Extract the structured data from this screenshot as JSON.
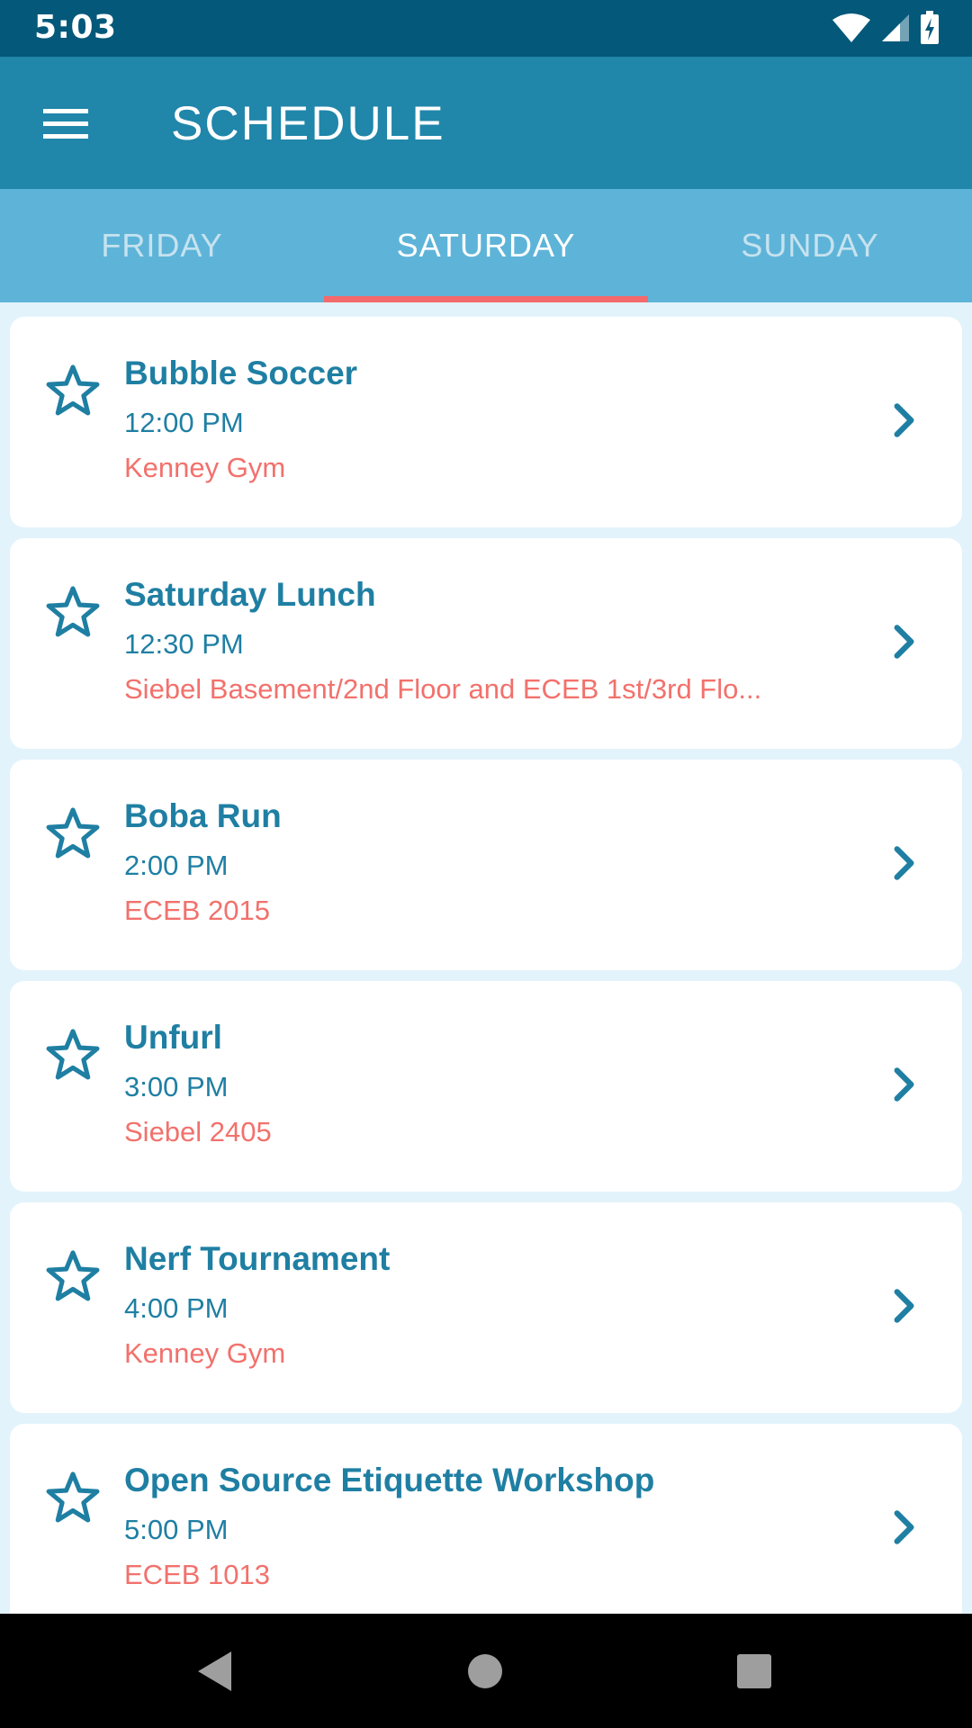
{
  "status_bar": {
    "time": "5:03",
    "icons": [
      "wifi-icon",
      "cell-signal-icon",
      "battery-charging-icon"
    ]
  },
  "app_bar": {
    "title": "SCHEDULE",
    "menu_icon": "menu-icon"
  },
  "tabs": [
    {
      "label": "FRIDAY",
      "active": false
    },
    {
      "label": "SATURDAY",
      "active": true
    },
    {
      "label": "SUNDAY",
      "active": false
    }
  ],
  "events": [
    {
      "name": "Bubble Soccer",
      "time": "12:00 PM",
      "location": "Kenney Gym"
    },
    {
      "name": "Saturday Lunch",
      "time": "12:30 PM",
      "location": "Siebel Basement/2nd Floor and ECEB 1st/3rd Flo..."
    },
    {
      "name": "Boba Run",
      "time": "2:00 PM",
      "location": "ECEB 2015"
    },
    {
      "name": "Unfurl",
      "time": "3:00 PM",
      "location": "Siebel 2405"
    },
    {
      "name": "Nerf Tournament",
      "time": "4:00 PM",
      "location": "Kenney Gym"
    },
    {
      "name": "Open Source Etiquette Workshop",
      "time": "5:00 PM",
      "location": "ECEB 1013"
    }
  ],
  "colors": {
    "status_bar": "#04587a",
    "app_bar": "#2086aa",
    "tab_bar": "#5eb4d8",
    "tab_indicator": "#f26a6c",
    "event_title": "#1f7fa3",
    "event_location": "#f2716c",
    "background": "#e3f3fb"
  },
  "nav_bar": {
    "buttons": [
      "back-icon",
      "home-icon",
      "recents-icon"
    ]
  }
}
